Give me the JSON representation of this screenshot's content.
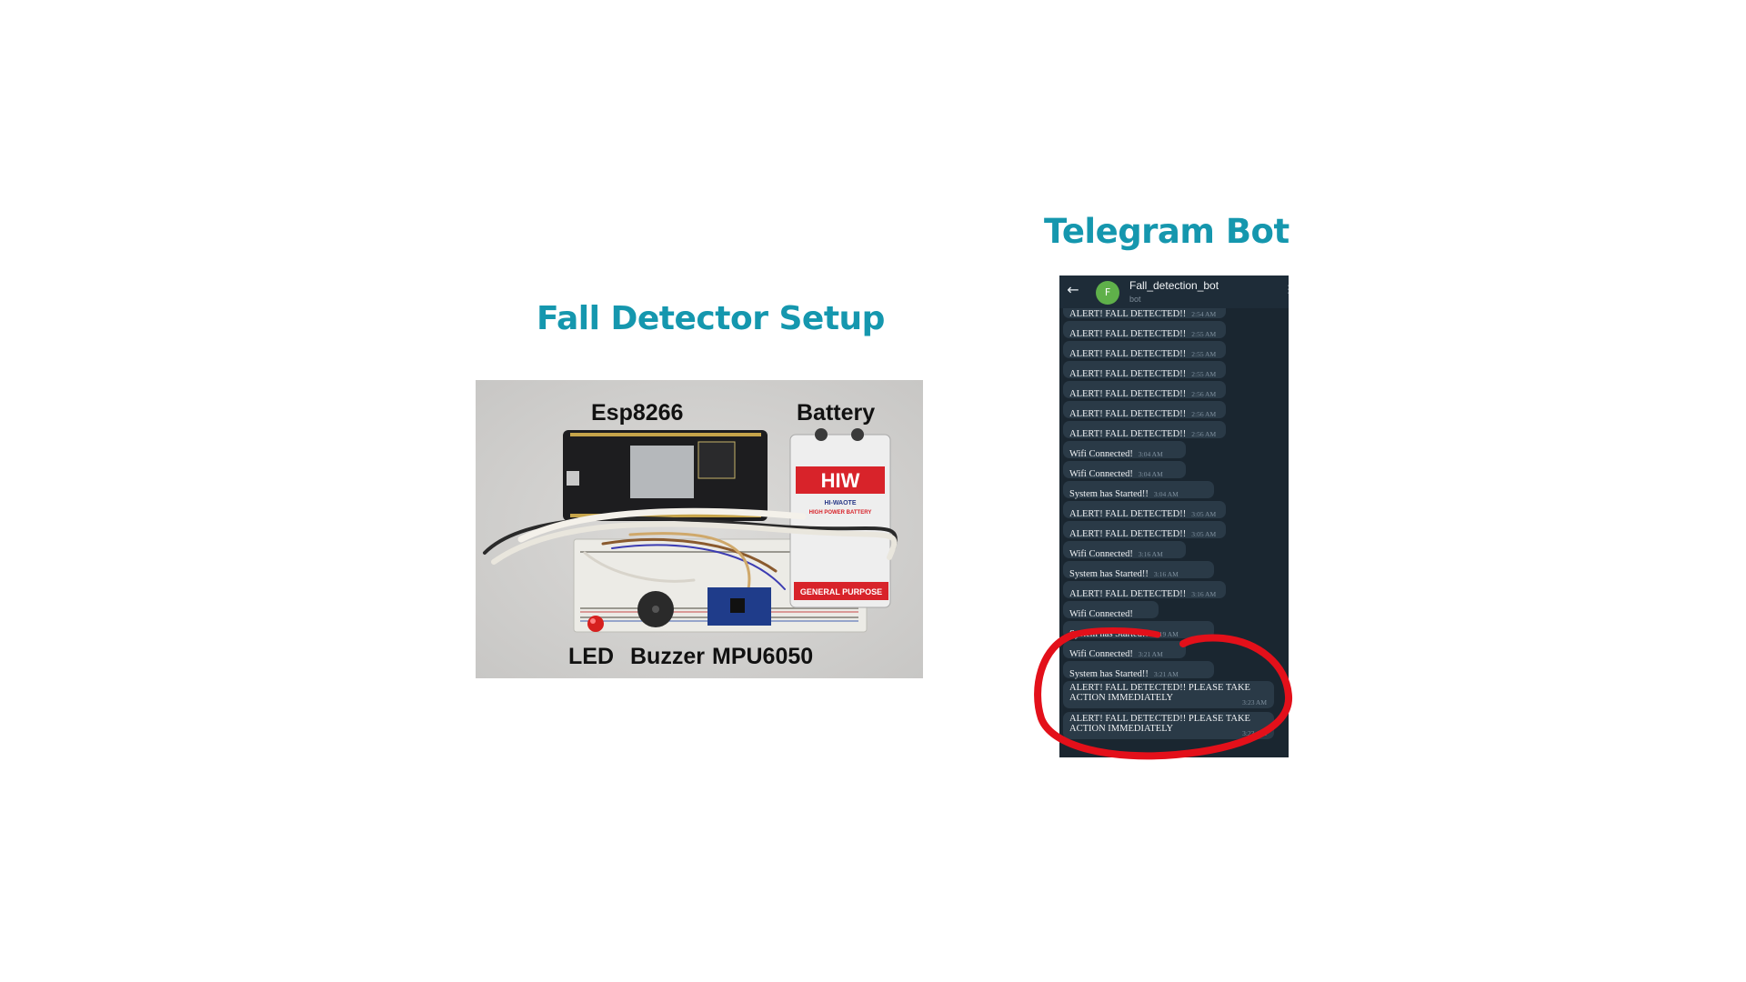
{
  "headings": {
    "setup": "Fall Detector Setup",
    "bot": "Telegram Bot"
  },
  "photo_labels": {
    "esp": "Esp8266",
    "battery": "Battery",
    "led": "LED",
    "buzzer": "Buzzer",
    "mpu": "MPU6050"
  },
  "photo_text": {
    "battery_brand": "HIW",
    "battery_sub": "HI-WAOTE",
    "battery_tag": "HIGH POWER BATTERY",
    "battery_purpose": "GENERAL PURPOSE"
  },
  "telegram": {
    "bot_name": "Fall_detection_bot",
    "bot_sub": "bot",
    "avatar_letter": "F",
    "messages": [
      {
        "text": "ALERT! FALL DETECTED!!",
        "time": "2:54 AM"
      },
      {
        "text": "ALERT! FALL DETECTED!!",
        "time": "2:55 AM"
      },
      {
        "text": "ALERT! FALL DETECTED!!",
        "time": "2:55 AM"
      },
      {
        "text": "ALERT! FALL DETECTED!!",
        "time": "2:55 AM"
      },
      {
        "text": "ALERT! FALL DETECTED!!",
        "time": "2:56 AM"
      },
      {
        "text": "ALERT! FALL DETECTED!!",
        "time": "2:56 AM"
      },
      {
        "text": "ALERT! FALL DETECTED!!",
        "time": "2:56 AM"
      },
      {
        "text": "Wifi Connected!",
        "time": "3:04 AM"
      },
      {
        "text": "Wifi Connected!",
        "time": "3:04 AM"
      },
      {
        "text": "System has Started!!",
        "time": "3:04 AM"
      },
      {
        "text": "ALERT! FALL DETECTED!!",
        "time": "3:05 AM"
      },
      {
        "text": "ALERT! FALL DETECTED!!",
        "time": "3:05 AM"
      },
      {
        "text": "Wifi Connected!",
        "time": "3:16 AM"
      },
      {
        "text": "System has Started!!",
        "time": "3:16 AM"
      },
      {
        "text": "ALERT! FALL DETECTED!!",
        "time": "3:16 AM"
      },
      {
        "text": "Wifi Connected!",
        "time": ""
      },
      {
        "text": "System has Started!!",
        "time": "3:19 AM"
      },
      {
        "text": "Wifi Connected!",
        "time": "3:21 AM"
      },
      {
        "text": "System has Started!!",
        "time": "3:21 AM"
      },
      {
        "text": "ALERT! FALL DETECTED!! PLEASE TAKE ACTION IMMEDIATELY",
        "time": "3:23 AM"
      },
      {
        "text": "ALERT! FALL DETECTED!! PLEASE TAKE ACTION IMMEDIATELY",
        "time": "3:23 AM"
      }
    ]
  },
  "colors": {
    "heading": "#1597ae",
    "telegram_bg": "#1a2630",
    "bubble": "#2a3a47",
    "highlight_circle": "#e3101a"
  }
}
